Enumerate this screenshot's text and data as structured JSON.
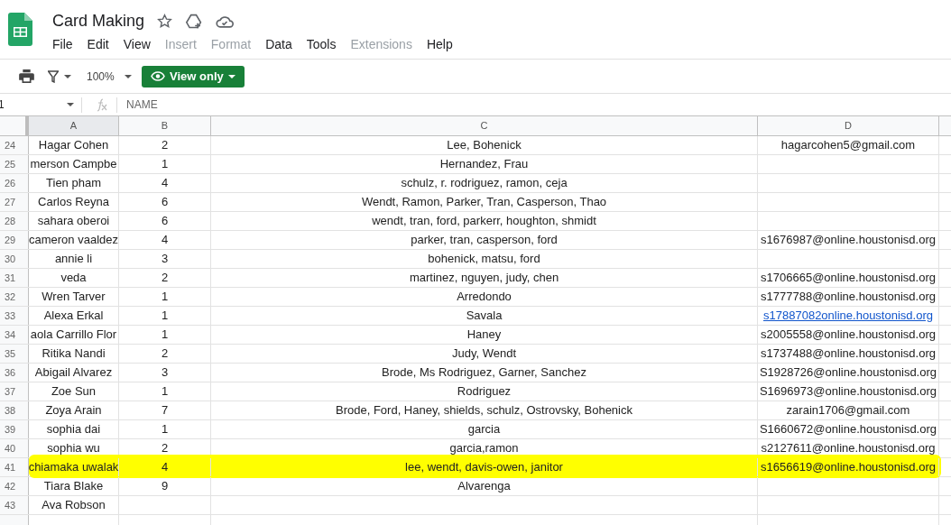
{
  "document": {
    "title": "Card Making"
  },
  "menu": [
    {
      "label": "File",
      "disabled": false
    },
    {
      "label": "Edit",
      "disabled": false
    },
    {
      "label": "View",
      "disabled": false
    },
    {
      "label": "Insert",
      "disabled": true
    },
    {
      "label": "Format",
      "disabled": true
    },
    {
      "label": "Data",
      "disabled": false
    },
    {
      "label": "Tools",
      "disabled": false
    },
    {
      "label": "Extensions",
      "disabled": true
    },
    {
      "label": "Help",
      "disabled": false
    }
  ],
  "toolbar": {
    "zoom": "100%",
    "mode_button": "View only"
  },
  "formula_bar": {
    "cell": "1",
    "content": "NAME"
  },
  "columns": [
    "A",
    "B",
    "C",
    "D"
  ],
  "rows": [
    {
      "number": "24",
      "a": "Hagar Cohen",
      "b": "2",
      "c": "Lee, Bohenick",
      "d": "hagarcohen5@gmail.com",
      "d_link": false,
      "highlighted": false
    },
    {
      "number": "25",
      "a": "merson Campbe",
      "b": "1",
      "c": "Hernandez, Frau",
      "d": "",
      "d_link": false,
      "highlighted": false
    },
    {
      "number": "26",
      "a": "Tien pham",
      "b": "4",
      "c": "schulz, r. rodriguez, ramon, ceja",
      "d": "",
      "d_link": false,
      "highlighted": false
    },
    {
      "number": "27",
      "a": "Carlos Reyna",
      "b": "6",
      "c": "Wendt, Ramon, Parker, Tran, Casperson, Thao",
      "d": "",
      "d_link": false,
      "highlighted": false
    },
    {
      "number": "28",
      "a": "sahara oberoi",
      "b": "6",
      "c": "wendt, tran, ford, parkerr, houghton, shmidt",
      "d": "",
      "d_link": false,
      "highlighted": false
    },
    {
      "number": "29",
      "a": "cameron vaaldez",
      "b": "4",
      "c": "parker, tran, casperson, ford",
      "d": "s1676987@online.houstonisd.org",
      "d_link": false,
      "highlighted": false
    },
    {
      "number": "30",
      "a": "annie li",
      "b": "3",
      "c": "bohenick, matsu, ford",
      "d": "",
      "d_link": false,
      "highlighted": false
    },
    {
      "number": "31",
      "a": "veda",
      "b": "2",
      "c": "martinez, nguyen, judy, chen",
      "d": "s1706665@online.houstonisd.org",
      "d_link": false,
      "highlighted": false
    },
    {
      "number": "32",
      "a": "Wren Tarver",
      "b": "1",
      "c": "Arredondo",
      "d": "s1777788@online.houstonisd.org",
      "d_link": false,
      "highlighted": false
    },
    {
      "number": "33",
      "a": "Alexa Erkal",
      "b": "1",
      "c": "Savala",
      "d": "s17887082online.houstonisd.org",
      "d_link": true,
      "highlighted": false
    },
    {
      "number": "34",
      "a": "aola Carrillo Flor",
      "b": "1",
      "c": "Haney",
      "d": "s2005558@online.houstonisd.org",
      "d_link": false,
      "highlighted": false
    },
    {
      "number": "35",
      "a": "Ritika Nandi",
      "b": "2",
      "c": "Judy, Wendt",
      "d": "s1737488@online.houstonisd.org",
      "d_link": false,
      "highlighted": false
    },
    {
      "number": "36",
      "a": "Abigail Alvarez",
      "b": "3",
      "c": "Brode, Ms Rodriguez, Garner, Sanchez",
      "d": "S1928726@online.houstonisd.org",
      "d_link": false,
      "highlighted": false
    },
    {
      "number": "37",
      "a": "Zoe Sun",
      "b": "1",
      "c": "Rodriguez",
      "d": "S1696973@online.houstonisd.org",
      "d_link": false,
      "highlighted": false
    },
    {
      "number": "38",
      "a": "Zoya Arain",
      "b": "7",
      "c": "Brode, Ford, Haney, shields, schulz, Ostrovsky, Bohenick",
      "d": "zarain1706@gmail.com",
      "d_link": false,
      "highlighted": false
    },
    {
      "number": "39",
      "a": "sophia dai",
      "b": "1",
      "c": "garcia",
      "d": "S1660672@online.houstonisd.org",
      "d_link": false,
      "highlighted": false
    },
    {
      "number": "40",
      "a": "sophia wu",
      "b": "2",
      "c": "garcia,ramon",
      "d": "s2127611@online.houstonisd.org",
      "d_link": false,
      "highlighted": false
    },
    {
      "number": "41",
      "a": "chiamaka uwalak",
      "b": "4",
      "c": "lee, wendt, davis-owen, janitor",
      "d": "s1656619@online.houstonisd.org",
      "d_link": false,
      "highlighted": true
    },
    {
      "number": "42",
      "a": "Tiara Blake",
      "b": "9",
      "c": "Alvarenga",
      "d": "",
      "d_link": false,
      "highlighted": false
    },
    {
      "number": "43",
      "a": "Ava Robson",
      "b": "",
      "c": "",
      "d": "",
      "d_link": false,
      "highlighted": false
    }
  ]
}
